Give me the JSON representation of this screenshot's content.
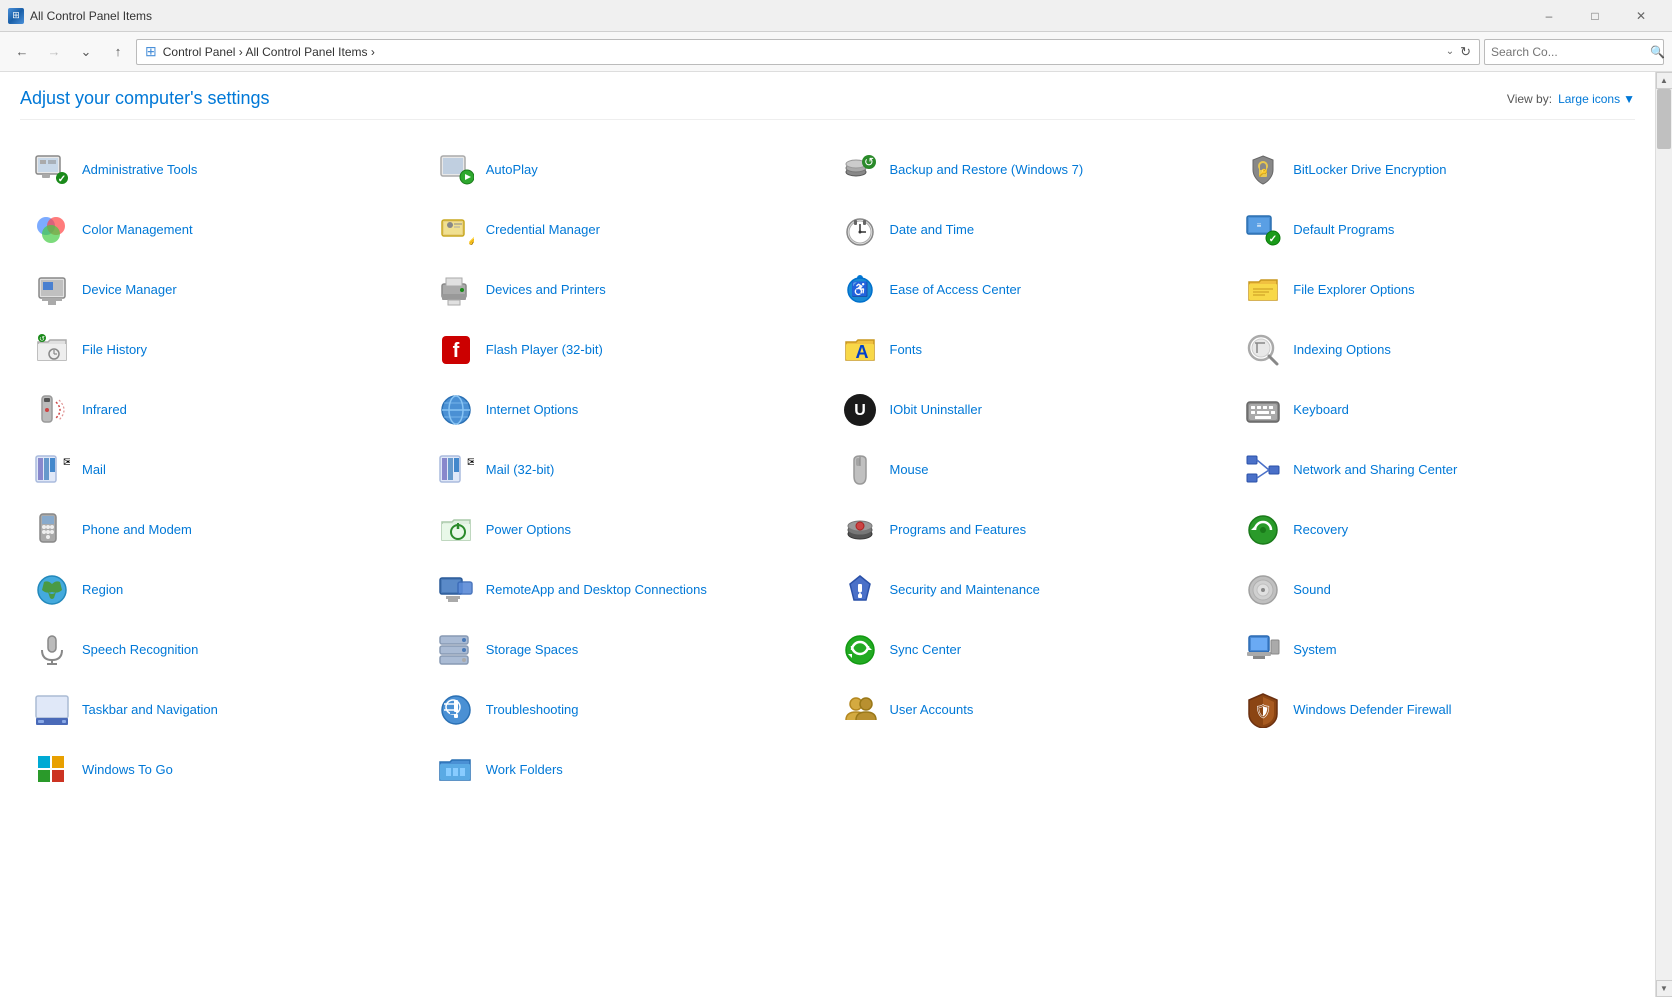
{
  "titleBar": {
    "title": "All Control Panel Items",
    "icon": "control-panel-icon",
    "minimizeLabel": "–",
    "maximizeLabel": "□",
    "closeLabel": "✕"
  },
  "addressBar": {
    "backDisabled": false,
    "forwardDisabled": true,
    "upLabel": "↑",
    "path": "Control Panel  ›  All Control Panel Items  ›",
    "searchPlaceholder": "Search Co...",
    "refreshLabel": "⟳"
  },
  "header": {
    "title": "Adjust your computer's settings",
    "viewByLabel": "View by:",
    "viewByValue": "Large icons",
    "viewByChevron": "▼"
  },
  "items": [
    {
      "id": "admin-tools",
      "label": "Administrative Tools",
      "icon": "🔧",
      "color": "#555"
    },
    {
      "id": "autoplay",
      "label": "AutoPlay",
      "icon": "▶",
      "color": "#1a8a1a"
    },
    {
      "id": "backup-restore",
      "label": "Backup and Restore (Windows 7)",
      "icon": "💾",
      "color": "#1a7a1a"
    },
    {
      "id": "bitlocker",
      "label": "BitLocker Drive Encryption",
      "icon": "🔑",
      "color": "#888"
    },
    {
      "id": "color-management",
      "label": "Color Management",
      "icon": "🎨",
      "color": "#555"
    },
    {
      "id": "credential-manager",
      "label": "Credential Manager",
      "icon": "🗝",
      "color": "#888"
    },
    {
      "id": "date-time",
      "label": "Date and Time",
      "icon": "🕐",
      "color": "#555"
    },
    {
      "id": "default-programs",
      "label": "Default Programs",
      "icon": "✔",
      "color": "#1a7a1a"
    },
    {
      "id": "device-manager",
      "label": "Device Manager",
      "icon": "🖨",
      "color": "#555"
    },
    {
      "id": "devices-printers",
      "label": "Devices and Printers",
      "icon": "🖨",
      "color": "#555"
    },
    {
      "id": "ease-of-access",
      "label": "Ease of Access Center",
      "icon": "♿",
      "color": "#1a7aaa"
    },
    {
      "id": "file-explorer-options",
      "label": "File Explorer Options",
      "icon": "📁",
      "color": "#d4a800"
    },
    {
      "id": "file-history",
      "label": "File History",
      "icon": "🗄",
      "color": "#555"
    },
    {
      "id": "flash-player",
      "label": "Flash Player (32-bit)",
      "icon": "⚡",
      "color": "#cc0000"
    },
    {
      "id": "fonts",
      "label": "Fonts",
      "icon": "A",
      "color": "#d4a800"
    },
    {
      "id": "indexing-options",
      "label": "Indexing Options",
      "icon": "🔍",
      "color": "#888"
    },
    {
      "id": "infrared",
      "label": "Infrared",
      "icon": "📡",
      "color": "#555"
    },
    {
      "id": "internet-options",
      "label": "Internet Options",
      "icon": "🌐",
      "color": "#1a7aaa"
    },
    {
      "id": "iobit-uninstaller",
      "label": "IObit Uninstaller",
      "icon": "U",
      "color": "#1a1a1a"
    },
    {
      "id": "keyboard",
      "label": "Keyboard",
      "icon": "⌨",
      "color": "#555"
    },
    {
      "id": "mail",
      "label": "Mail",
      "icon": "📊",
      "color": "#1a5fa8"
    },
    {
      "id": "mail-32bit",
      "label": "Mail (32-bit)",
      "icon": "📊",
      "color": "#1a5fa8"
    },
    {
      "id": "mouse",
      "label": "Mouse",
      "icon": "🖱",
      "color": "#555"
    },
    {
      "id": "network-sharing",
      "label": "Network and Sharing Center",
      "icon": "🌐",
      "color": "#1a5fa8"
    },
    {
      "id": "phone-modem",
      "label": "Phone and Modem",
      "icon": "📞",
      "color": "#555"
    },
    {
      "id": "power-options",
      "label": "Power Options",
      "icon": "⚡",
      "color": "#1a7a1a"
    },
    {
      "id": "programs-features",
      "label": "Programs and Features",
      "icon": "💿",
      "color": "#555"
    },
    {
      "id": "recovery",
      "label": "Recovery",
      "icon": "♻",
      "color": "#1a8a1a"
    },
    {
      "id": "region",
      "label": "Region",
      "icon": "🌍",
      "color": "#1a7aaa"
    },
    {
      "id": "remoteapp",
      "label": "RemoteApp and Desktop Connections",
      "icon": "🖥",
      "color": "#1a5fa8"
    },
    {
      "id": "security-maintenance",
      "label": "Security and Maintenance",
      "icon": "🚩",
      "color": "#1a5fa8"
    },
    {
      "id": "sound",
      "label": "Sound",
      "icon": "🔊",
      "color": "#888"
    },
    {
      "id": "speech-recognition",
      "label": "Speech Recognition",
      "icon": "🎤",
      "color": "#555"
    },
    {
      "id": "storage-spaces",
      "label": "Storage Spaces",
      "icon": "🗄",
      "color": "#1a5fa8"
    },
    {
      "id": "sync-center",
      "label": "Sync Center",
      "icon": "🔄",
      "color": "#1a8a1a"
    },
    {
      "id": "system",
      "label": "System",
      "icon": "🖥",
      "color": "#1a5fa8"
    },
    {
      "id": "taskbar-navigation",
      "label": "Taskbar and Navigation",
      "icon": "📋",
      "color": "#1a5fa8"
    },
    {
      "id": "troubleshooting",
      "label": "Troubleshooting",
      "icon": "🔧",
      "color": "#1a5fa8"
    },
    {
      "id": "user-accounts",
      "label": "User Accounts",
      "icon": "👥",
      "color": "#d4a800"
    },
    {
      "id": "windows-defender-firewall",
      "label": "Windows Defender Firewall",
      "icon": "🛡",
      "color": "#8B4513"
    },
    {
      "id": "windows-to-go",
      "label": "Windows To Go",
      "icon": "🔵",
      "color": "#1a5fa8"
    },
    {
      "id": "work-folders",
      "label": "Work Folders",
      "icon": "📁",
      "color": "#d4a800"
    }
  ],
  "icons": {
    "admin-tools": {
      "type": "gear-wrench",
      "emoji": "🔧"
    },
    "autoplay": {
      "type": "play-disc",
      "emoji": "💿"
    },
    "backup-restore": {
      "type": "backup",
      "emoji": "💾"
    },
    "bitlocker": {
      "type": "key-lock",
      "emoji": "🔑"
    },
    "color-management": {
      "type": "color",
      "emoji": "🎨"
    },
    "credential-manager": {
      "type": "credentials",
      "emoji": "🗝"
    },
    "date-time": {
      "type": "clock",
      "emoji": "🕐"
    },
    "default-programs": {
      "type": "checkmark",
      "emoji": "✔"
    },
    "device-manager": {
      "type": "computer",
      "emoji": "🖨"
    },
    "devices-printers": {
      "type": "printer",
      "emoji": "🖨"
    },
    "ease-of-access": {
      "type": "accessibility",
      "emoji": "♿"
    },
    "file-explorer-options": {
      "type": "folder",
      "emoji": "📁"
    },
    "file-history": {
      "type": "history",
      "emoji": "🕐"
    },
    "flash-player": {
      "type": "flash",
      "emoji": "⚡"
    },
    "fonts": {
      "type": "font-a",
      "emoji": "A"
    },
    "indexing-options": {
      "type": "search",
      "emoji": "🔍"
    },
    "infrared": {
      "type": "signal",
      "emoji": "📡"
    },
    "internet-options": {
      "type": "globe",
      "emoji": "🌐"
    },
    "iobit-uninstaller": {
      "type": "circle-u",
      "emoji": "U"
    },
    "keyboard": {
      "type": "keyboard",
      "emoji": "⌨"
    },
    "mail": {
      "type": "mail-chart",
      "emoji": "📊"
    },
    "mail-32bit": {
      "type": "mail-chart",
      "emoji": "📊"
    },
    "mouse": {
      "type": "mouse",
      "emoji": "🖱"
    },
    "network-sharing": {
      "type": "network",
      "emoji": "🌐"
    },
    "phone-modem": {
      "type": "phone",
      "emoji": "📞"
    },
    "power-options": {
      "type": "lightning",
      "emoji": "⚡"
    },
    "programs-features": {
      "type": "disc",
      "emoji": "💿"
    },
    "recovery": {
      "type": "recycle",
      "emoji": "♻"
    },
    "region": {
      "type": "globe",
      "emoji": "🌍"
    },
    "remoteapp": {
      "type": "remote",
      "emoji": "🖥"
    },
    "security-maintenance": {
      "type": "flag",
      "emoji": "🚩"
    },
    "sound": {
      "type": "speaker",
      "emoji": "🔊"
    },
    "speech-recognition": {
      "type": "microphone",
      "emoji": "🎤"
    },
    "storage-spaces": {
      "type": "drives",
      "emoji": "💾"
    },
    "sync-center": {
      "type": "sync",
      "emoji": "🔄"
    },
    "system": {
      "type": "computer",
      "emoji": "🖥"
    },
    "taskbar-navigation": {
      "type": "taskbar",
      "emoji": "📋"
    },
    "troubleshooting": {
      "type": "wrench",
      "emoji": "🔧"
    },
    "user-accounts": {
      "type": "users",
      "emoji": "👥"
    },
    "windows-defender-firewall": {
      "type": "shield",
      "emoji": "🛡"
    },
    "windows-to-go": {
      "type": "windows",
      "emoji": "⊞"
    },
    "work-folders": {
      "type": "folder-work",
      "emoji": "📁"
    }
  }
}
